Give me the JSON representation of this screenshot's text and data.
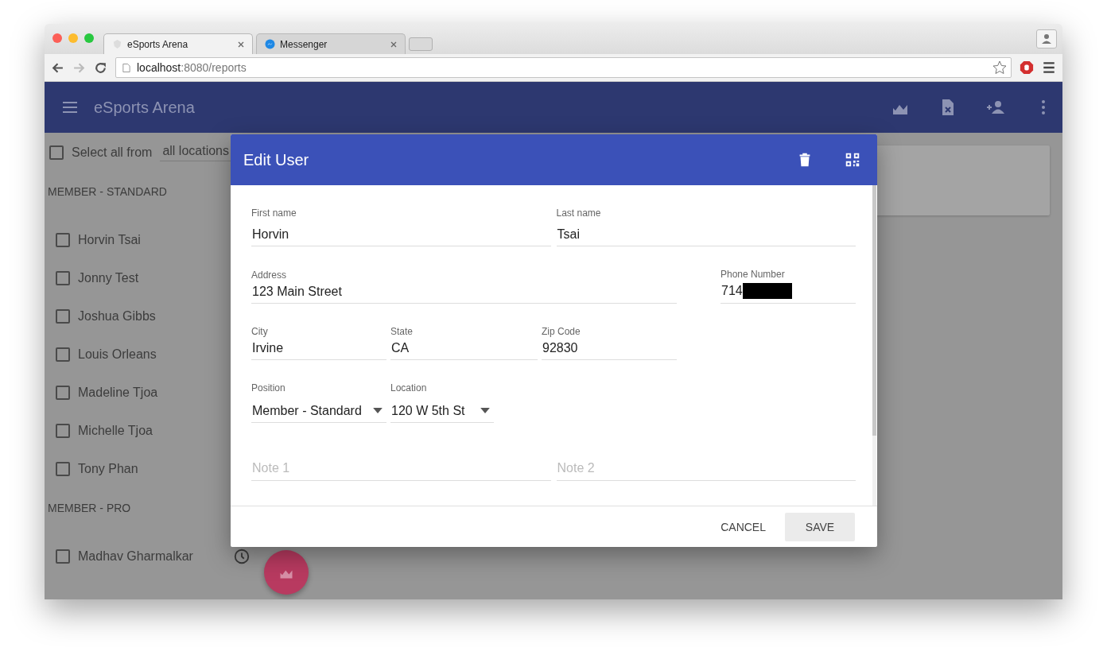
{
  "browser": {
    "tabs": [
      {
        "title": "eSports Arena",
        "selected": true
      },
      {
        "title": "Messenger",
        "selected": false
      }
    ],
    "url": {
      "host": "localhost",
      "rest": ":8080/reports"
    }
  },
  "app_bar": {
    "title": "eSports Arena"
  },
  "sidebar": {
    "select_all": {
      "label": "Select all from",
      "checked": false,
      "location": "all locations"
    },
    "groups": [
      {
        "heading": "MEMBER - STANDARD",
        "members": [
          {
            "name": "Horvin Tsai",
            "checked": false
          },
          {
            "name": "Jonny Test",
            "checked": false
          },
          {
            "name": "Joshua Gibbs",
            "checked": false
          },
          {
            "name": "Louis Orleans",
            "checked": false
          },
          {
            "name": "Madeline Tjoa",
            "checked": false
          },
          {
            "name": "Michelle Tjoa",
            "checked": false
          },
          {
            "name": "Tony Phan",
            "checked": false
          }
        ]
      },
      {
        "heading": "MEMBER - PRO",
        "members": [
          {
            "name": "Madhav Gharmalkar",
            "checked": false
          }
        ]
      }
    ]
  },
  "dialog": {
    "title": "Edit User",
    "rows": [
      [
        {
          "kind": "text",
          "label": "First name",
          "value": "Horvin"
        },
        {
          "kind": "text",
          "label": "Last name",
          "value": "Tsai"
        }
      ],
      [
        {
          "kind": "text",
          "label": "Address",
          "value": "123 Main Street"
        },
        {
          "kind": "text",
          "label": "Phone Number",
          "value": "714",
          "redacted": true
        }
      ],
      [
        {
          "kind": "text",
          "label": "City",
          "value": "Irvine"
        },
        {
          "kind": "text",
          "label": "State",
          "value": "CA"
        },
        {
          "kind": "text",
          "label": "Zip Code",
          "value": "92830"
        }
      ],
      [
        {
          "kind": "select",
          "label": "Position",
          "value": "Member - Standard"
        },
        {
          "kind": "select",
          "label": "Location",
          "value": "120 W 5th St"
        }
      ],
      [
        {
          "kind": "empty",
          "placeholder": "Note 1"
        },
        {
          "kind": "empty",
          "placeholder": "Note 2"
        }
      ]
    ],
    "buttons": [
      {
        "label": "CANCEL",
        "kind": "flat"
      },
      {
        "label": "SAVE",
        "kind": "raised"
      }
    ]
  }
}
